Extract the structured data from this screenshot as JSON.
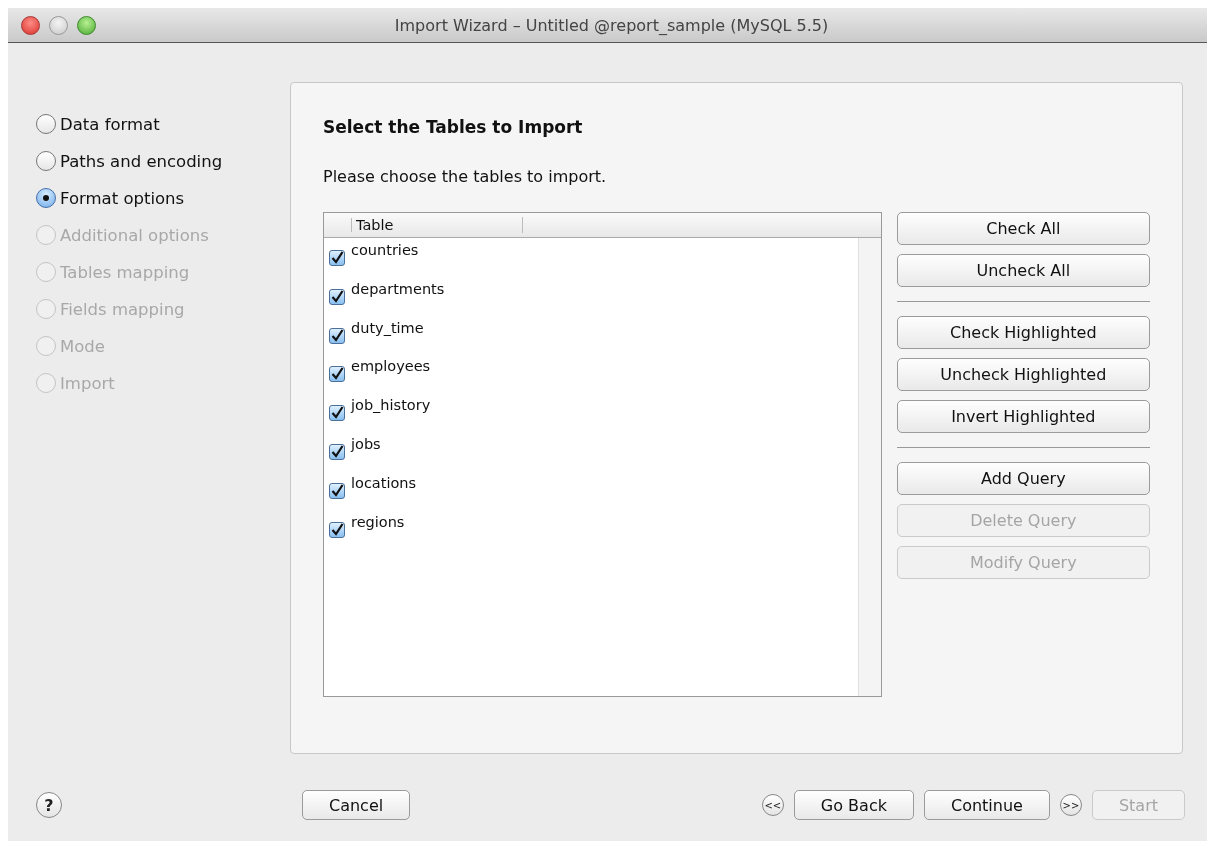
{
  "window": {
    "title": "Import Wizard – Untitled @report_sample (MySQL 5.5)"
  },
  "steps": [
    {
      "label": "Data format",
      "selected": false,
      "disabled": false
    },
    {
      "label": "Paths and encoding",
      "selected": false,
      "disabled": false
    },
    {
      "label": "Format options",
      "selected": true,
      "disabled": false
    },
    {
      "label": "Additional options",
      "selected": false,
      "disabled": true
    },
    {
      "label": "Tables mapping",
      "selected": false,
      "disabled": true
    },
    {
      "label": "Fields mapping",
      "selected": false,
      "disabled": true
    },
    {
      "label": "Mode",
      "selected": false,
      "disabled": true
    },
    {
      "label": "Import",
      "selected": false,
      "disabled": true
    }
  ],
  "heading": "Select the Tables to Import",
  "instruction": "Please choose the tables to import.",
  "table": {
    "columns": [
      "Table"
    ],
    "rows": [
      {
        "name": "countries",
        "checked": true
      },
      {
        "name": "departments",
        "checked": true
      },
      {
        "name": "duty_time",
        "checked": true
      },
      {
        "name": "employees",
        "checked": true
      },
      {
        "name": "job_history",
        "checked": true
      },
      {
        "name": "jobs",
        "checked": true
      },
      {
        "name": "locations",
        "checked": true
      },
      {
        "name": "regions",
        "checked": true
      }
    ]
  },
  "side_button_groups": [
    [
      {
        "label": "Check All",
        "disabled": false
      },
      {
        "label": "Uncheck All",
        "disabled": false
      }
    ],
    [
      {
        "label": "Check Highlighted",
        "disabled": false
      },
      {
        "label": "Uncheck Highlighted",
        "disabled": false
      },
      {
        "label": "Invert Highlighted",
        "disabled": false
      }
    ],
    [
      {
        "label": "Add Query",
        "disabled": false
      },
      {
        "label": "Delete Query",
        "disabled": true
      },
      {
        "label": "Modify Query",
        "disabled": true
      }
    ]
  ],
  "footer": {
    "help": "?",
    "cancel": "Cancel",
    "buttons": [
      {
        "kind": "round",
        "label": "<<",
        "disabled": false
      },
      {
        "kind": "push",
        "label": "Go Back",
        "disabled": false
      },
      {
        "kind": "push",
        "label": "Continue",
        "disabled": false
      },
      {
        "kind": "round",
        "label": ">>",
        "disabled": false
      },
      {
        "kind": "push",
        "label": "Start",
        "disabled": true
      }
    ]
  }
}
